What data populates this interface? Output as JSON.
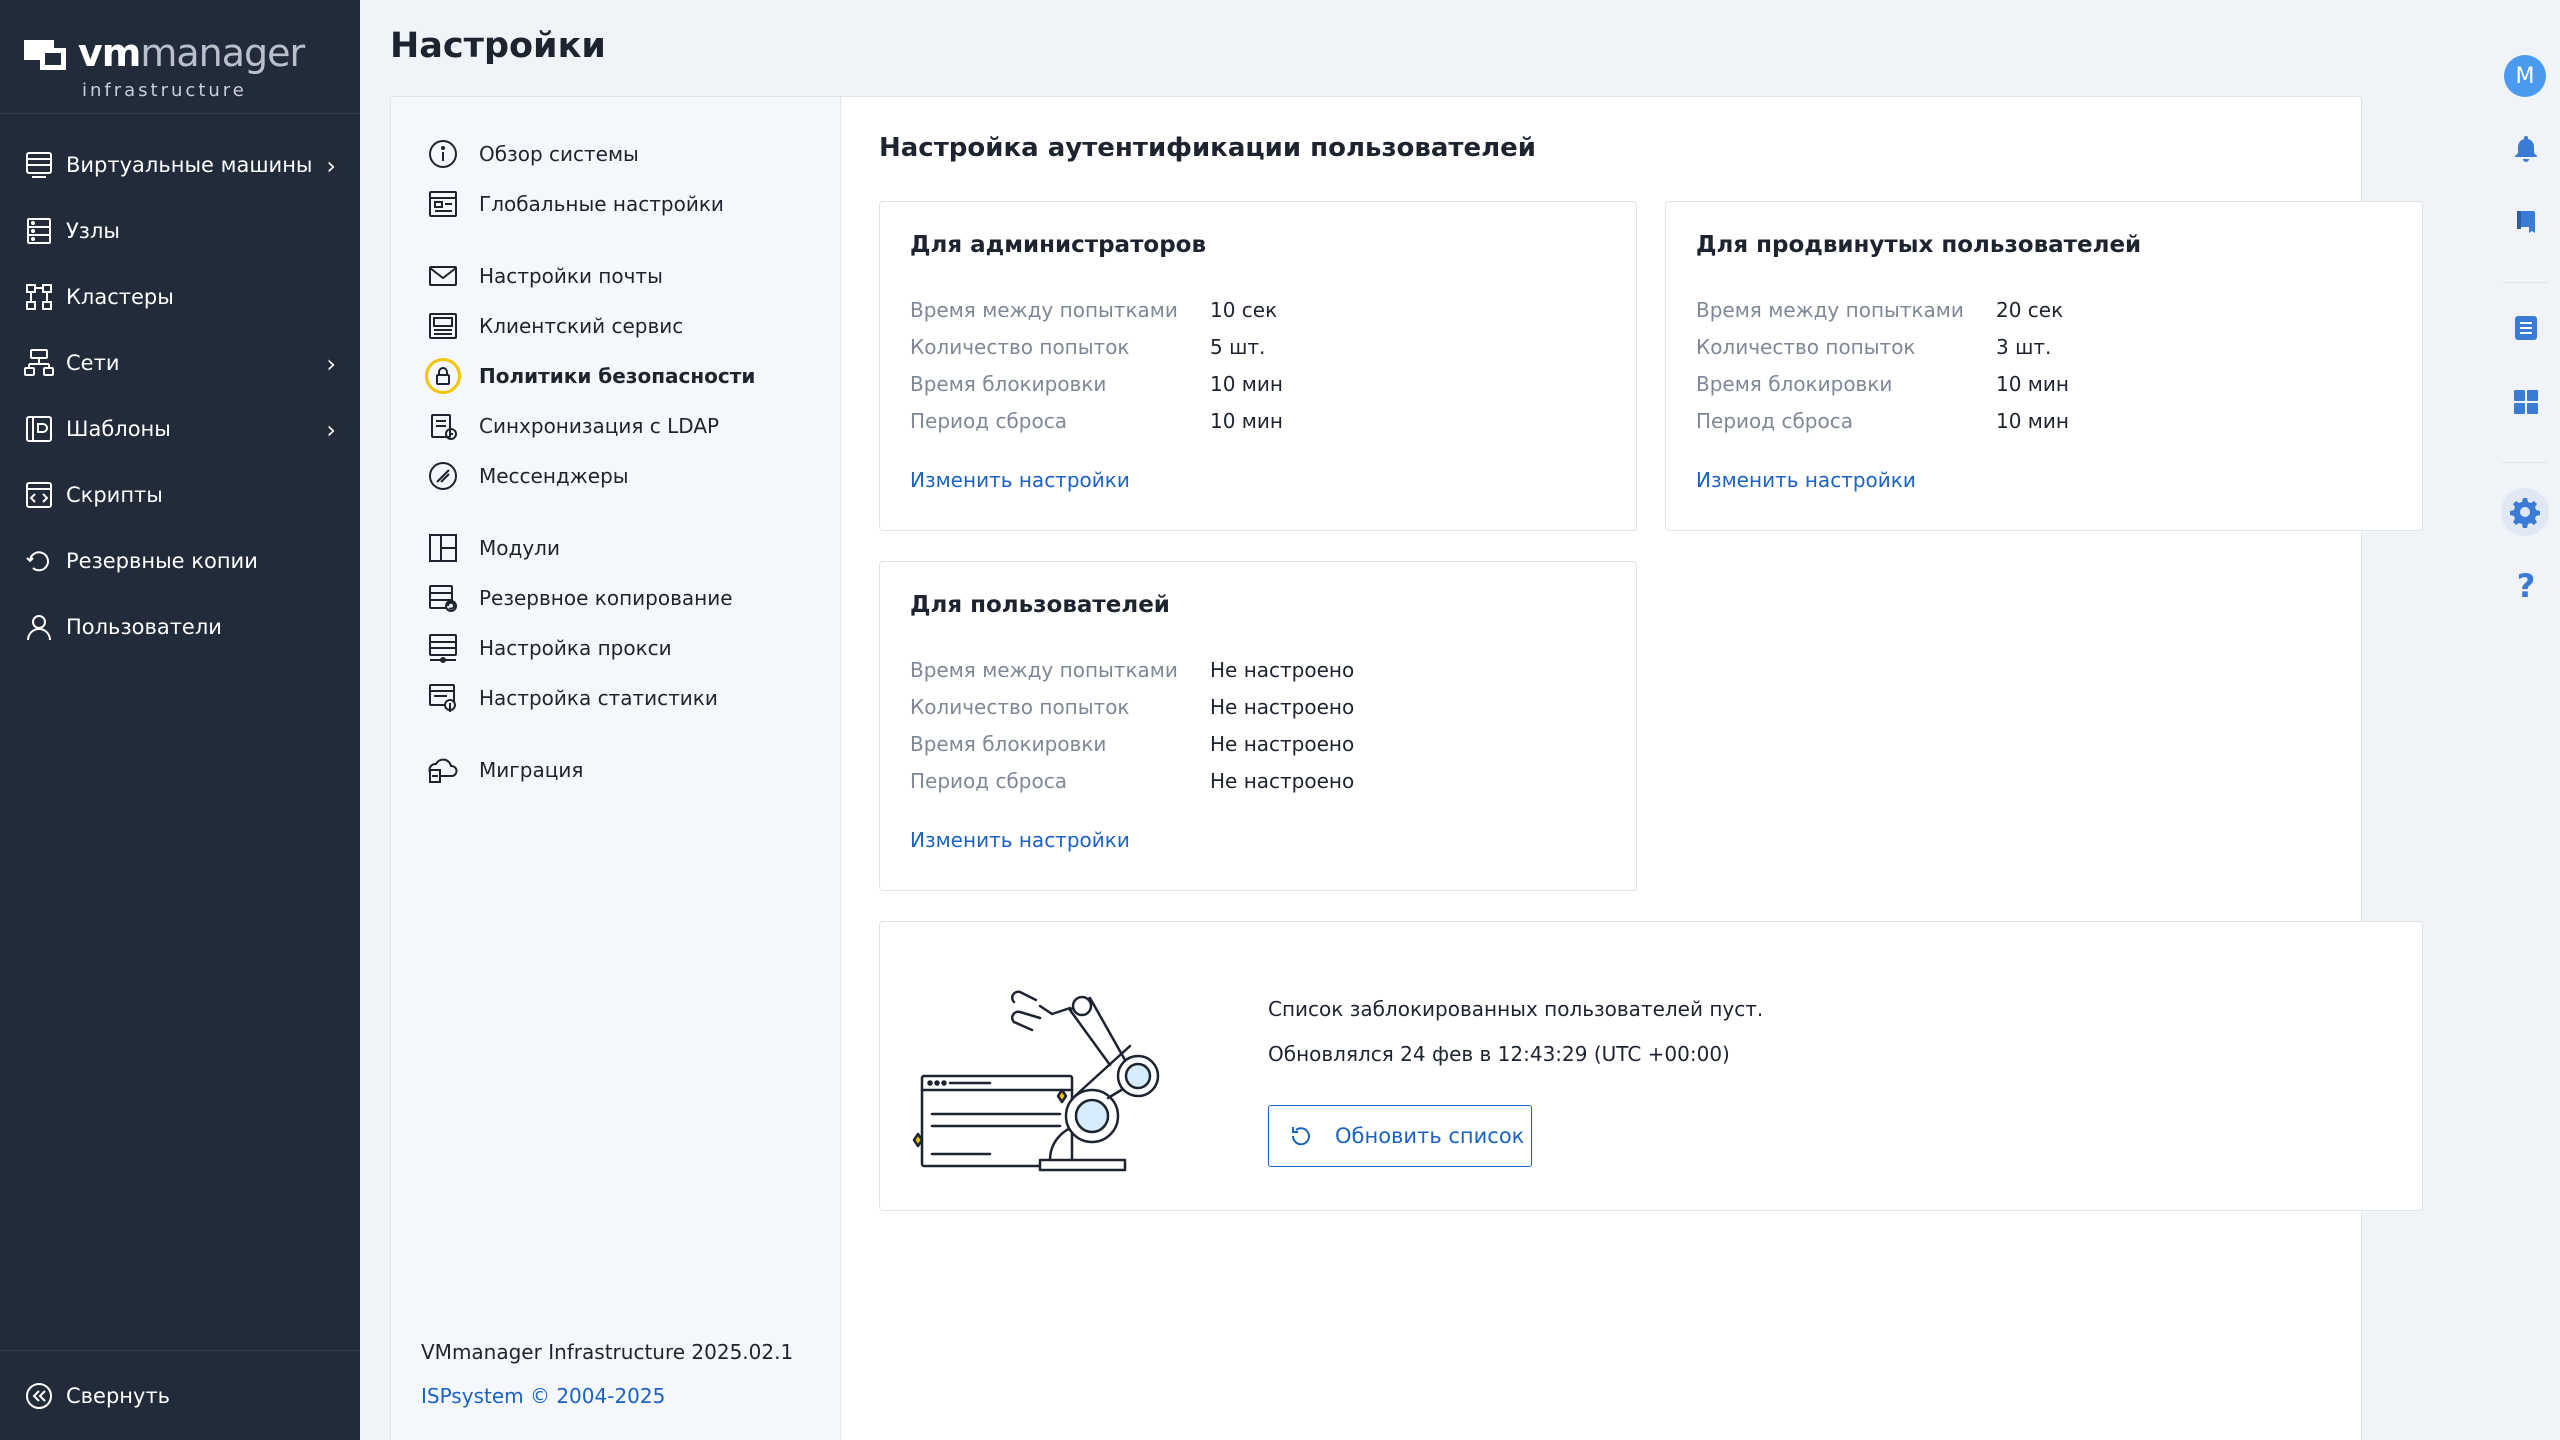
{
  "app": {
    "logo_vm": "vm",
    "logo_manager": "manager",
    "logo_sub": "infrastructure",
    "page_title": "Настройки"
  },
  "sidebar": {
    "items": [
      {
        "label": "Виртуальные машины",
        "icon": "vm-icon",
        "has_submenu": true
      },
      {
        "label": "Узлы",
        "icon": "nodes-icon",
        "has_submenu": false
      },
      {
        "label": "Кластеры",
        "icon": "cluster-icon",
        "has_submenu": false
      },
      {
        "label": "Сети",
        "icon": "network-icon",
        "has_submenu": true
      },
      {
        "label": "Шаблоны",
        "icon": "template-icon",
        "has_submenu": true
      },
      {
        "label": "Скрипты",
        "icon": "script-icon",
        "has_submenu": false
      },
      {
        "label": "Резервные копии",
        "icon": "backup-icon",
        "has_submenu": false
      },
      {
        "label": "Пользователи",
        "icon": "user-icon",
        "has_submenu": false
      }
    ],
    "collapse_label": "Свернуть"
  },
  "submenu": {
    "groups": [
      [
        {
          "label": "Обзор системы",
          "icon": "info-icon"
        },
        {
          "label": "Глобальные настройки",
          "icon": "global-settings-icon"
        }
      ],
      [
        {
          "label": "Настройки почты",
          "icon": "mail-icon"
        },
        {
          "label": "Клиентский сервис",
          "icon": "client-service-icon"
        },
        {
          "label": "Политики безопасности",
          "icon": "lock-icon",
          "active": true
        },
        {
          "label": "Синхронизация с LDAP",
          "icon": "ldap-sync-icon"
        },
        {
          "label": "Мессенджеры",
          "icon": "messenger-icon"
        }
      ],
      [
        {
          "label": "Модули",
          "icon": "modules-icon"
        },
        {
          "label": "Резервное копирование",
          "icon": "backup-settings-icon"
        },
        {
          "label": "Настройка прокси",
          "icon": "proxy-icon"
        },
        {
          "label": "Настройка статистики",
          "icon": "statistics-icon"
        }
      ],
      [
        {
          "label": "Миграция",
          "icon": "migration-icon"
        }
      ]
    ],
    "version": "VMmanager Infrastructure 2025.02.1",
    "copyright": "ISPsystem © 2004-2025"
  },
  "auth": {
    "title": "Настройка аутентификации пользователей",
    "labels": {
      "interval": "Время между попытками",
      "attempts": "Количество попыток",
      "block_time": "Время блокировки",
      "reset_period": "Период сброса"
    },
    "change_link": "Изменить настройки",
    "admins": {
      "title": "Для администраторов",
      "interval": "10 сек",
      "attempts": "5 шт.",
      "block_time": "10 мин",
      "reset_period": "10 мин"
    },
    "advanced": {
      "title": "Для продвинутых пользователей",
      "interval": "20 сек",
      "attempts": "3 шт.",
      "block_time": "10 мин",
      "reset_period": "10 мин"
    },
    "users": {
      "title": "Для пользователей",
      "interval": "Не настроено",
      "attempts": "Не настроено",
      "block_time": "Не настроено",
      "reset_period": "Не настроено"
    }
  },
  "blocked": {
    "empty_text": "Список заблокированных пользователей пуст.",
    "updated_text": "Обновлялся 24 фев в 12:43:29 (UTC +00:00)",
    "refresh_label": "Обновить список"
  },
  "rail": {
    "avatar_letter": "M",
    "icons": [
      "bell-icon",
      "book-icon",
      "list-icon",
      "dashboard-icon",
      "gear-icon",
      "help-icon"
    ]
  },
  "colors": {
    "sidebar_bg": "#212b3a",
    "link": "#1a62c4",
    "active_ring": "#f2c500",
    "avatar": "#4a9bf0"
  }
}
